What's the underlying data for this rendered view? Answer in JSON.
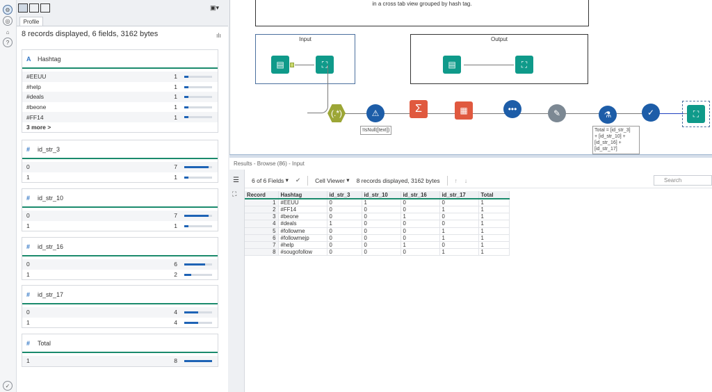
{
  "profile": {
    "tab": "Profile",
    "summary": "8 records displayed, 6 fields, 3162 bytes",
    "more_label": "3 more >",
    "cards": [
      {
        "type": "A",
        "field": "Hashtag",
        "rows": [
          {
            "label": "#EEUU",
            "count": "1",
            "frac": 0.14
          },
          {
            "label": "#help",
            "count": "1",
            "frac": 0.14
          },
          {
            "label": "#deals",
            "count": "1",
            "frac": 0.14
          },
          {
            "label": "#beone",
            "count": "1",
            "frac": 0.14
          },
          {
            "label": "#FF14",
            "count": "1",
            "frac": 0.14
          }
        ]
      },
      {
        "type": "#",
        "field": "id_str_3",
        "rows": [
          {
            "label": "0",
            "count": "7",
            "frac": 0.88
          },
          {
            "label": "1",
            "count": "1",
            "frac": 0.14
          }
        ]
      },
      {
        "type": "#",
        "field": "id_str_10",
        "rows": [
          {
            "label": "0",
            "count": "7",
            "frac": 0.88
          },
          {
            "label": "1",
            "count": "1",
            "frac": 0.14
          }
        ]
      },
      {
        "type": "#",
        "field": "id_str_16",
        "rows": [
          {
            "label": "0",
            "count": "6",
            "frac": 0.75
          },
          {
            "label": "1",
            "count": "2",
            "frac": 0.25
          }
        ]
      },
      {
        "type": "#",
        "field": "id_str_17",
        "rows": [
          {
            "label": "0",
            "count": "4",
            "frac": 0.5
          },
          {
            "label": "1",
            "count": "4",
            "frac": 0.5
          }
        ]
      },
      {
        "type": "#",
        "field": "Total",
        "rows": [
          {
            "label": "1",
            "count": "8",
            "frac": 1.0
          }
        ]
      }
    ]
  },
  "canvas": {
    "comment_text": "in a cross tab view grouped by hash tag.",
    "input_title": "Input",
    "output_title": "Output",
    "filter_annotation": "!IsNull([text])",
    "formula_annotation": [
      "Total = [id_str_3]",
      "+ [id_str_10] +",
      "[id_str_16] +",
      "[id_str_17]"
    ]
  },
  "results": {
    "title": "Results - Browse (86) - Input",
    "fields_label": "6 of 6 Fields",
    "viewer_label": "Cell Viewer",
    "records_label": "8 records displayed, 3162 bytes",
    "search_placeholder": "Search",
    "columns": [
      "Record",
      "Hashtag",
      "id_str_3",
      "id_str_10",
      "id_str_16",
      "id_str_17",
      "Total"
    ],
    "rows": [
      [
        "1",
        "#EEUU",
        "0",
        "1",
        "0",
        "0",
        "1"
      ],
      [
        "2",
        "#FF14",
        "0",
        "0",
        "0",
        "1",
        "1"
      ],
      [
        "3",
        "#beone",
        "0",
        "0",
        "1",
        "0",
        "1"
      ],
      [
        "4",
        "#deals",
        "1",
        "0",
        "0",
        "0",
        "1"
      ],
      [
        "5",
        "#followme",
        "0",
        "0",
        "0",
        "1",
        "1"
      ],
      [
        "6",
        "#followmejp",
        "0",
        "0",
        "0",
        "1",
        "1"
      ],
      [
        "7",
        "#help",
        "0",
        "0",
        "1",
        "0",
        "1"
      ],
      [
        "8",
        "#sougofollow",
        "0",
        "0",
        "0",
        "1",
        "1"
      ]
    ]
  },
  "colors": {
    "accent_green": "#1a8a6c",
    "bar_blue": "#1e63b5",
    "tool_teal": "#0f9a8a"
  }
}
